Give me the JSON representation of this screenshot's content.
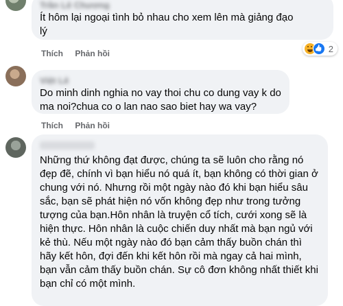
{
  "comments": [
    {
      "author": "Trần Lê Chương",
      "text": "Ít hôm lại ngoại tình bỏ nhau cho xem lên mà giảng đạo lý",
      "actions": {
        "like": "Thích",
        "reply": "Phản hồi"
      },
      "reactions": {
        "icons": [
          "haha-icon",
          "like-icon"
        ],
        "count": "2"
      }
    },
    {
      "author": "Việt Lê",
      "text": "Do minh dinh nghia no vay thoi chu co dung vay k do ma noi?chua co o lan nao sao biet hay wa vay?",
      "actions": {
        "like": "Thích",
        "reply": "Phản hồi"
      }
    },
    {
      "author": "",
      "text": "Những thứ không đạt được, chúng ta sẽ luôn cho rằng nó đẹp đẽ, chính vì bạn hiểu nó quá ít, bạn không có thời gian ở chung với nó. Nhưng rồi một ngày nào đó khi bạn hiểu sâu sắc, bạn sẽ phát hiện nó vốn không đẹp như trong tưởng tượng của bạn.Hôn nhân là truyện cổ tích, cưới xong sẽ là hiện thực. Hôn nhân là cuộc chiến duy nhất mà bạn ngủ với kẻ thù. Nếu một ngày nào đó bạn cảm thấy buồn chán thì hãy kết hôn, đợi đến khi kết hôn rồi mà ngay cả hai mình, bạn vẫn cảm thấy buồn chán. Sự cô đơn không nhất thiết khi bạn chỉ có một mình."
    }
  ]
}
